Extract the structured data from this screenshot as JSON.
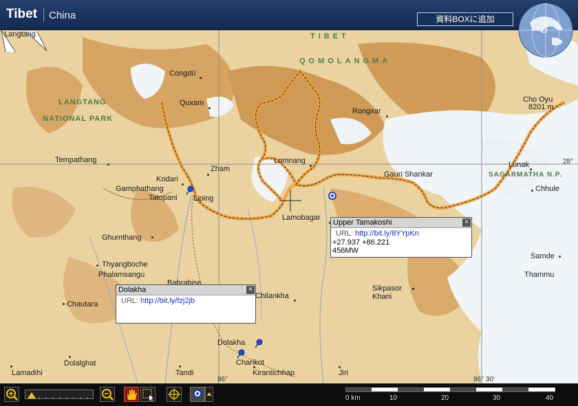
{
  "header": {
    "title": "Tibet",
    "subtitle": "China",
    "add_button": "資料BOXに追加"
  },
  "map": {
    "region_labels": {
      "tibet": "TIBET",
      "qomolangma": "QOMOLANGMA",
      "langtang1": "LANGTANG",
      "langtang2": "NATIONAL PARK",
      "sagarmatha": "SAGARMATHA N.P."
    },
    "places": {
      "langtang": "Langtang",
      "congdu": "Congdü",
      "quxam": "Quxam",
      "rongxar": "Rongxar",
      "cho_oyu": "Cho Oyu",
      "cho_oyu_elev": "8201 m",
      "tempathang": "Tempathang",
      "zham": "Zham",
      "lomnang": "Lomnang",
      "gauri_shankar": "Gauri Shankar",
      "lunak": "Lunak",
      "kodari": "Kodari",
      "gamphathang": "Gamphathang",
      "tatopani": "Tatopani",
      "liping": "Liping",
      "chhule": "Chhule",
      "lamobagar": "Lamobagar",
      "ghumthang": "Ghumthang",
      "thyangboche": "Thyangboche",
      "phalamsangu": "Phalamsangu",
      "babrabise": "Babrabise",
      "samde": "Samde",
      "thammu": "Thammu",
      "sikpasor": "Sikpasor",
      "khani": "Khani",
      "chautara": "Chautara",
      "chilankha": "Chilankha",
      "dolakha": "Dolakha",
      "dolalghat": "Dolalghat",
      "charikot": "Charikot",
      "lamadihi": "Lamadihi",
      "tandi": "Tandi",
      "kirantichhap": "Kirantichhap",
      "jiri": "Jiri"
    },
    "coords": {
      "lat_28": "28°",
      "lon_86": "86°",
      "lon_86_30": "86° 30'"
    }
  },
  "popups": {
    "tamakoshi": {
      "title": "Upper Tamakoshi",
      "url_label": "URL:",
      "url": "http://bit.ly/8YYpKn",
      "lines": [
        "+27.937 +86.221",
        "456MW"
      ],
      "close": "×"
    },
    "dolakha": {
      "title": "Dolakha",
      "url_label": "URL:",
      "url": "http://bit.ly/fzj2jb",
      "close": "×"
    }
  },
  "scale": {
    "labels": [
      "0 km",
      "10",
      "20",
      "30",
      "40"
    ]
  },
  "colors": {
    "header": "#1c3460",
    "terrain": "#ead3a0",
    "mountain": "#cf9a55",
    "glacier": "#f2f5f7",
    "border_route": "#e08a1e",
    "popup_link": "#1a2fb0"
  },
  "icons": [
    "globe-icon",
    "zoom-in-icon",
    "zoom-out-icon",
    "hand-icon",
    "select-icon",
    "crosshair-icon",
    "pin-icon",
    "map-pin-icon"
  ]
}
